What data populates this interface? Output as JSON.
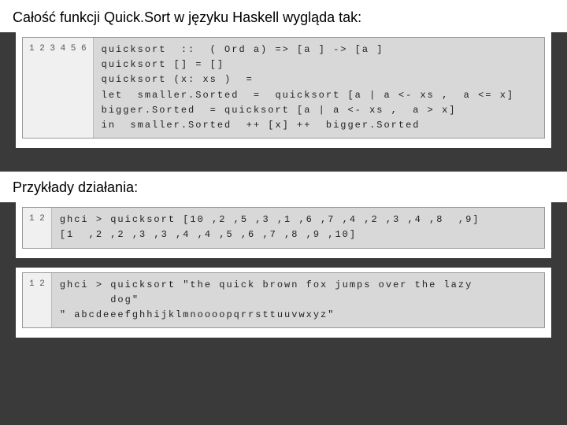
{
  "heading1": "Całość funkcji Quick.Sort w języku Haskell wygląda tak:",
  "heading2": "Przykłady działania:",
  "block1": {
    "line_numbers": "1\n2\n3\n4\n5\n6",
    "code": "quicksort  ::  ( Ord a) => [a ] -> [a ]\nquicksort [] = []\nquicksort (x: xs )  =\nlet  smaller.Sorted  =  quicksort [a | a <- xs ,  a <= x]\nbigger.Sorted  = quicksort [a | a <- xs ,  a > x]\nin  smaller.Sorted  ++ [x] ++  bigger.Sorted"
  },
  "block2": {
    "line_numbers": "1\n2",
    "code": "ghci > quicksort [10 ,2 ,5 ,3 ,1 ,6 ,7 ,4 ,2 ,3 ,4 ,8  ,9]\n[1  ,2 ,2 ,3 ,3 ,4 ,4 ,5 ,6 ,7 ,8 ,9 ,10]"
  },
  "block3": {
    "line_numbers": "1\n\n2",
    "code": "ghci > quicksort \"the quick brown fox jumps over the lazy\n       dog\"\n\" abcdeeefghhijklmnoooopqrrsttuuvwxyz\""
  }
}
